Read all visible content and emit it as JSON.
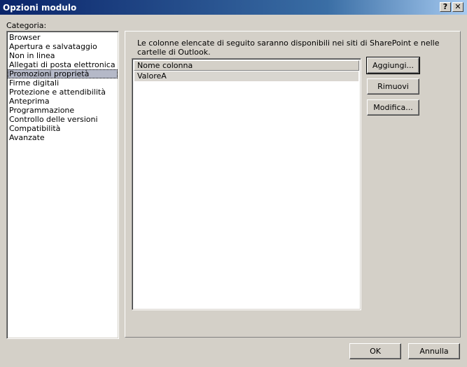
{
  "window": {
    "title": "Opzioni modulo",
    "help_btn": "?",
    "close_btn": "✕"
  },
  "category": {
    "label": "Categoria:",
    "items": [
      "Browser",
      "Apertura e salvataggio",
      "Non in linea",
      "Allegati di posta elettronica",
      "Promozioni proprietà",
      "Firme digitali",
      "Protezione e attendibilità",
      "Anteprima",
      "Programmazione",
      "Controllo delle versioni",
      "Compatibilità",
      "Avanzate"
    ],
    "selected": "Promozioni proprietà"
  },
  "panel": {
    "description": "Le colonne elencate di seguito saranno disponibili nei siti di SharePoint e nelle cartelle di Outlook.",
    "columns_header": "Nome colonna",
    "columns": [
      "ValoreA"
    ],
    "add_button": "Aggiungi...",
    "remove_button": "Rimuovi",
    "edit_button": "Modifica..."
  },
  "footer": {
    "ok_button": "OK",
    "cancel_button": "Annulla"
  }
}
